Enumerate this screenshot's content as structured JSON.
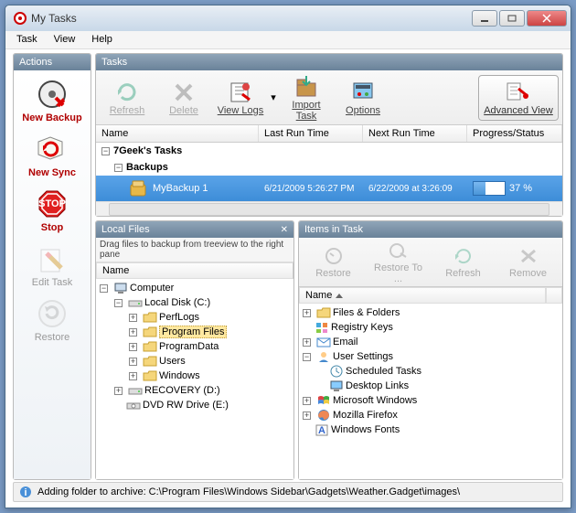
{
  "window": {
    "title": "My Tasks"
  },
  "menu": {
    "task": "Task",
    "view": "View",
    "help": "Help"
  },
  "actions": {
    "title": "Actions",
    "newBackup": "New Backup",
    "newSync": "New Sync",
    "stop": "Stop",
    "editTask": "Edit Task",
    "restore": "Restore"
  },
  "tasks": {
    "title": "Tasks",
    "toolbar": {
      "refresh": "Refresh",
      "delete": "Delete",
      "viewLogs": "View Logs",
      "importTask": "Import Task",
      "options": "Options",
      "advancedView": "Advanced View"
    },
    "columns": {
      "name": "Name",
      "lastRun": "Last Run Time",
      "nextRun": "Next Run Time",
      "progress": "Progress/Status"
    },
    "group1": "7Geek's Tasks",
    "group2": "Backups",
    "row": {
      "name": "MyBackup 1",
      "lastRun": "6/21/2009 5:26:27 PM",
      "nextRun": "6/22/2009  at 3:26:09",
      "progress": "37 %"
    }
  },
  "localFiles": {
    "title": "Local Files",
    "hint": "Drag files to backup from treeview to the right pane",
    "nameCol": "Name",
    "tree": {
      "computer": "Computer",
      "localDisk": "Local Disk (C:)",
      "perfLogs": "PerfLogs",
      "programFiles": "Program Files",
      "programData": "ProgramData",
      "users": "Users",
      "windows": "Windows",
      "recovery": "RECOVERY (D:)",
      "dvd": "DVD RW Drive (E:)"
    }
  },
  "itemsInTask": {
    "title": "Items in Task",
    "toolbar": {
      "restore": "Restore",
      "restoreTo": "Restore To ...",
      "refresh": "Refresh",
      "remove": "Remove"
    },
    "nameCol": "Name",
    "tree": {
      "filesFolders": "Files & Folders",
      "registryKeys": "Registry Keys",
      "email": "Email",
      "userSettings": "User Settings",
      "scheduledTasks": "Scheduled Tasks",
      "desktopLinks": "Desktop Links",
      "microsoftWindows": "Microsoft Windows",
      "mozillaFirefox": "Mozilla Firefox",
      "windowsFonts": "Windows Fonts"
    }
  },
  "status": {
    "text": "Adding folder to archive: C:\\Program Files\\Windows Sidebar\\Gadgets\\Weather.Gadget\\images\\"
  }
}
